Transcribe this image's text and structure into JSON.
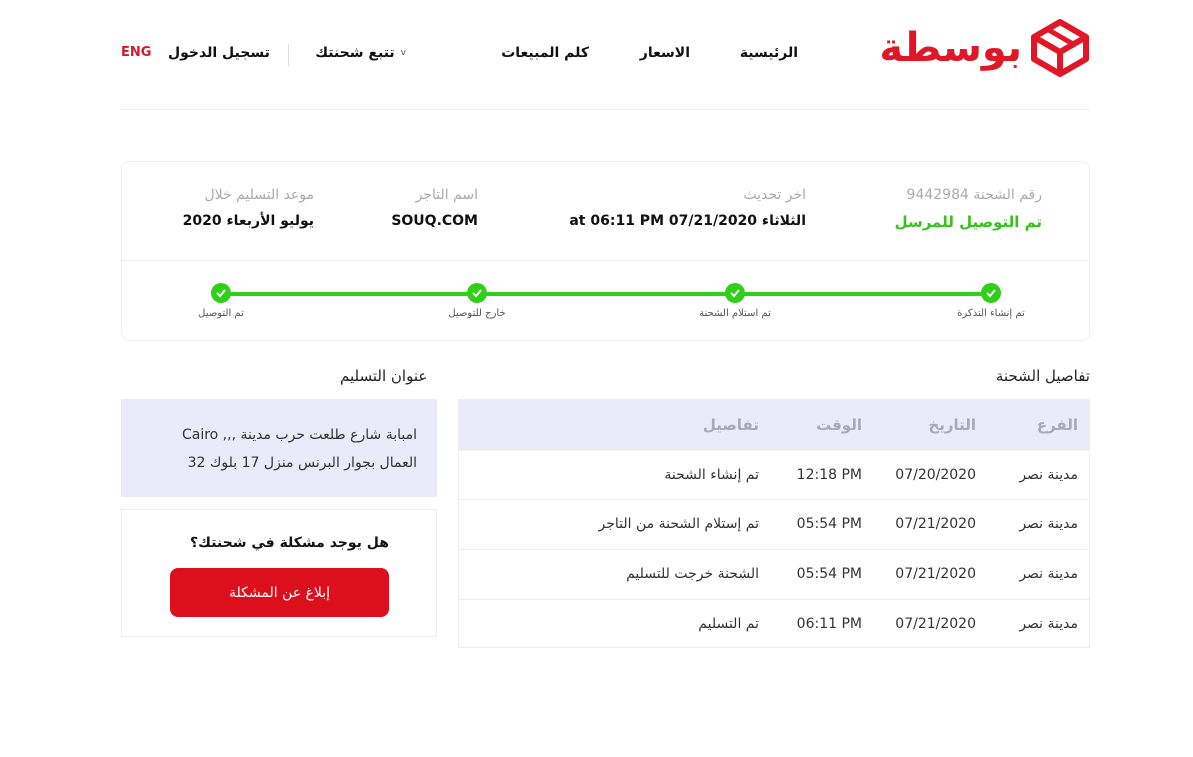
{
  "brand": {
    "name": "بوسطة",
    "color": "#e01726"
  },
  "nav": {
    "home": "الرئيسية",
    "prices": "الاسعار",
    "sales": "كلم المبيعات",
    "track": "تتبع شحنتك",
    "track_chevron": "v",
    "login": "تسجيل الدخول",
    "lang": "ENG"
  },
  "shipment": {
    "number_label": "رقم الشحنة 9442984",
    "status": "تم التوصيل للمرسل",
    "updated_label": "اخر تحديث",
    "updated_value": "الثلاثاء 07/21/2020 at 06:11 PM",
    "merchant_label": "اسم التاجر",
    "merchant_value": "SOUQ.COM",
    "delivery_label": "موعد التسليم خلال",
    "delivery_value": "يوليو الأربعاء 2020"
  },
  "tracker": {
    "steps": [
      "تم إنشاء التذكرة",
      "تم استلام الشحنة",
      "خارج للتوصيل",
      "تم التوصيل"
    ],
    "completed": 4,
    "color": "#2fcf1a"
  },
  "details": {
    "title": "تفاصيل الشحنة",
    "headers": {
      "branch": "الفرع",
      "date": "التاريخ",
      "time": "الوقت",
      "details": "تفاصيل"
    },
    "rows": [
      {
        "branch": "مدينة نصر",
        "date": "07/20/2020",
        "time": "12:18 PM",
        "details": "تم إنشاء الشحنة"
      },
      {
        "branch": "مدينة نصر",
        "date": "07/21/2020",
        "time": "05:54 PM",
        "details": "تم إستلام الشحنة من التاجر"
      },
      {
        "branch": "مدينة نصر",
        "date": "07/21/2020",
        "time": "05:54 PM",
        "details": "الشحنة خرجت للتسليم"
      },
      {
        "branch": "مدينة نصر",
        "date": "07/21/2020",
        "time": "06:11 PM",
        "details": "تم التسليم"
      }
    ]
  },
  "address": {
    "title": "عنوان التسليم",
    "line1": "امبابة شارع طلعت حرب مدينة ,,, Cairo",
    "line2": "العمال بجوار البرنس منزل 17 بلوك 32"
  },
  "problem": {
    "question": "هل يوجد مشكلة في شحنتك؟",
    "button": "إبلاغ عن المشكلة",
    "button_color": "#dc0f1d"
  }
}
